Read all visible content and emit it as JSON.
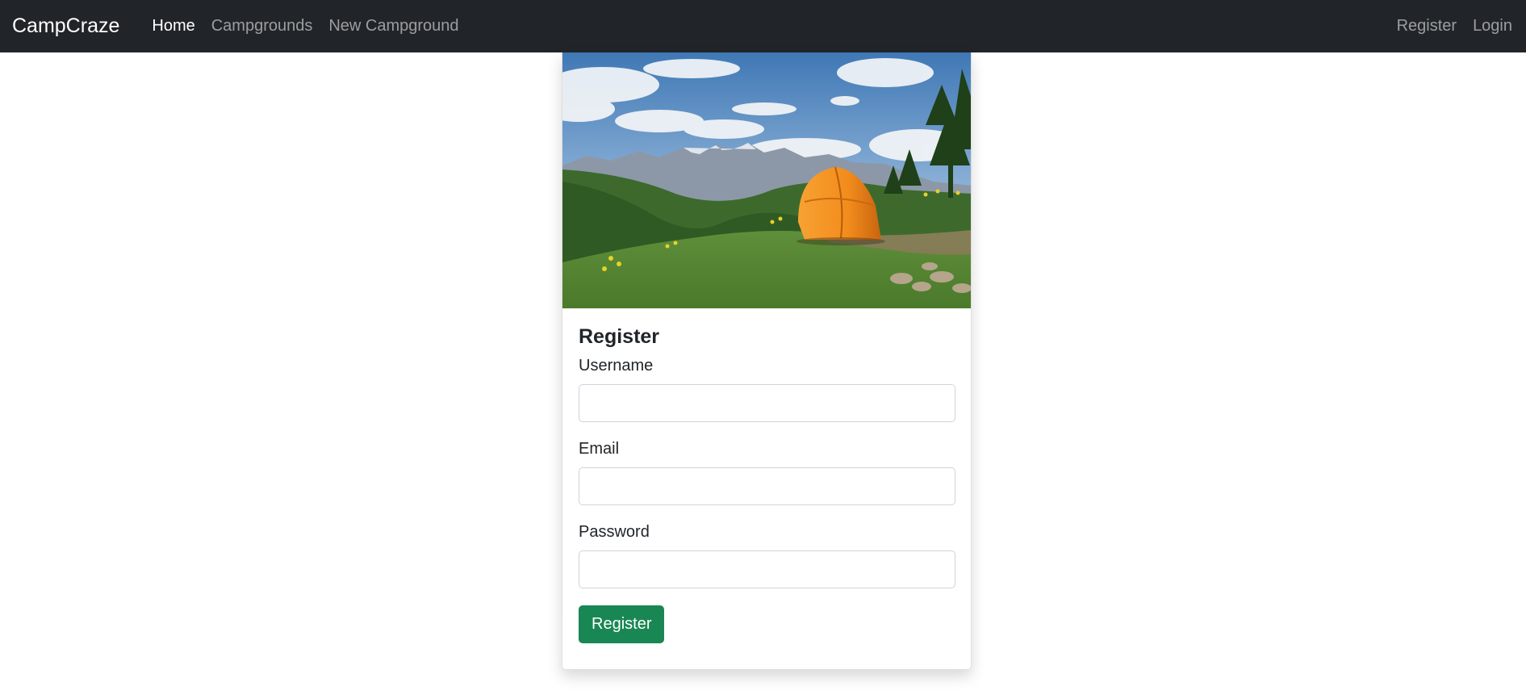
{
  "navbar": {
    "brand": "CampCraze",
    "links_left": [
      {
        "label": "Home",
        "active": true
      },
      {
        "label": "Campgrounds",
        "active": false
      },
      {
        "label": "New Campground",
        "active": false
      }
    ],
    "links_right": [
      {
        "label": "Register"
      },
      {
        "label": "Login"
      }
    ]
  },
  "card": {
    "image_alt": "Orange tent on a grassy hill with mountains in the distance",
    "title": "Register",
    "fields": [
      {
        "label": "Username",
        "value": "",
        "placeholder": ""
      },
      {
        "label": "Email",
        "value": "",
        "placeholder": ""
      },
      {
        "label": "Password",
        "value": "",
        "placeholder": ""
      }
    ],
    "submit_label": "Register"
  },
  "colors": {
    "navbar_bg": "#212529",
    "button_green": "#198754",
    "tent_orange": "#f28c1c"
  }
}
